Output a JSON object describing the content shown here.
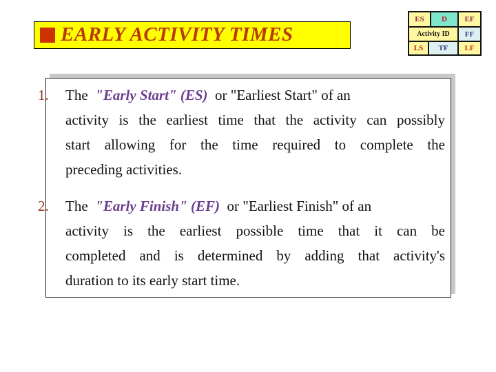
{
  "title": {
    "text": "EARLY ACTIVITY TIMES",
    "bullet_icon": "square-bullet"
  },
  "legend": {
    "cells": {
      "es": "ES",
      "d": "D",
      "ef": "EF",
      "activity_id": "Activity ID",
      "ff": "FF",
      "ls": "LS",
      "tf": "TF",
      "lf": "LF"
    }
  },
  "content": {
    "items": [
      {
        "number": "1.",
        "lines": {
          "l1_pre": "The",
          "l1_term": "\"Early Start\" (ES)",
          "l1_post": "or \"Earliest Start\" of an",
          "l2": "activity is the earliest time that the activity can possibly",
          "l3": "start allowing for the time required to complete the",
          "l4": "preceding activities."
        }
      },
      {
        "number": "2.",
        "lines": {
          "l1_pre": "The",
          "l1_term": "\"Early Finish\" (EF)",
          "l1_post": "or \"Earliest Finish\" of an",
          "l2": "activity is the earliest possible time that it can be",
          "l3": "completed and is determined by adding that activity's",
          "l4": "duration to its early start time."
        }
      }
    ]
  },
  "colors": {
    "title_bg": "#ffff00",
    "title_text": "#b83a0a",
    "term": "#6a3d8f",
    "number": "#8b3a1a"
  }
}
